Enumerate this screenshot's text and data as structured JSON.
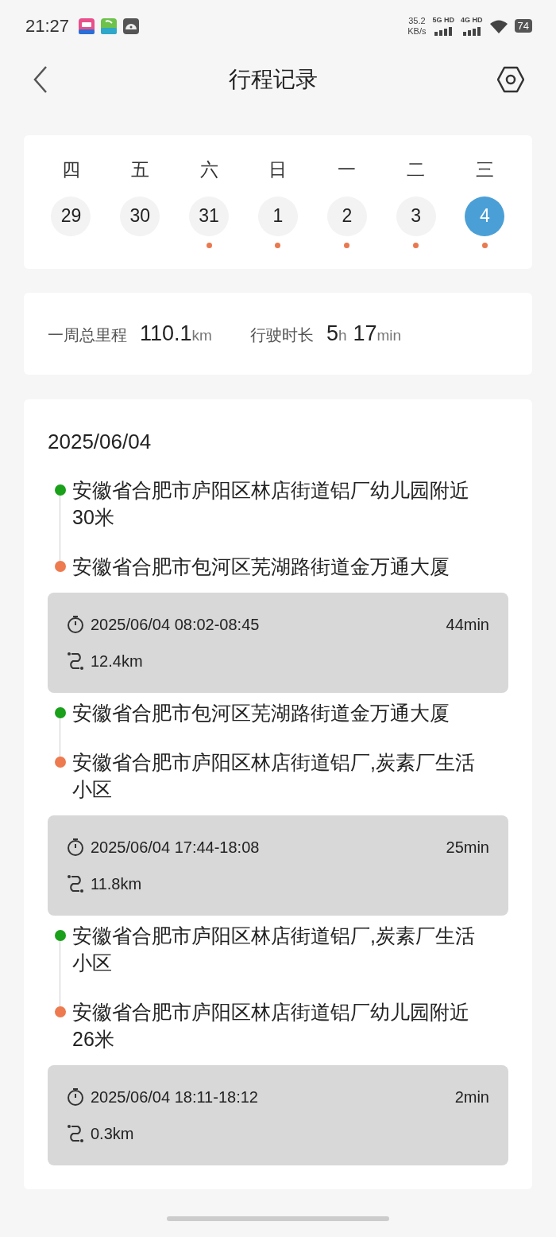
{
  "status_bar": {
    "time": "21:27",
    "speed": "35.2",
    "speed_unit": "KB/s",
    "networks": [
      "5G HD",
      "4G HD"
    ],
    "battery": "74"
  },
  "header": {
    "title": "行程记录"
  },
  "week": [
    {
      "weekday": "四",
      "date": "29",
      "selected": false,
      "has_trip": false
    },
    {
      "weekday": "五",
      "date": "30",
      "selected": false,
      "has_trip": false
    },
    {
      "weekday": "六",
      "date": "31",
      "selected": false,
      "has_trip": true
    },
    {
      "weekday": "日",
      "date": "1",
      "selected": false,
      "has_trip": true
    },
    {
      "weekday": "一",
      "date": "2",
      "selected": false,
      "has_trip": true
    },
    {
      "weekday": "二",
      "date": "3",
      "selected": false,
      "has_trip": true
    },
    {
      "weekday": "三",
      "date": "4",
      "selected": true,
      "has_trip": true
    }
  ],
  "summary": [
    {
      "label": "一周总里程",
      "parts": [
        {
          "value": "110.1",
          "unit": "km"
        }
      ]
    },
    {
      "label": "行驶时长",
      "parts": [
        {
          "value": "5",
          "unit": "h"
        },
        {
          "value": "17",
          "unit": "min"
        }
      ]
    }
  ],
  "day": {
    "date": "2025/06/04",
    "trips": [
      {
        "start": "安徽省合肥市庐阳区林店街道铝厂幼儿园附近30米",
        "end": "安徽省合肥市包河区芜湖路街道金万通大厦",
        "time": "2025/06/04 08:02-08:45",
        "duration": "44min",
        "distance": "12.4km"
      },
      {
        "start": "安徽省合肥市包河区芜湖路街道金万通大厦",
        "end": "安徽省合肥市庐阳区林店街道铝厂,炭素厂生活小区",
        "time": "2025/06/04 17:44-18:08",
        "duration": "25min",
        "distance": "11.8km"
      },
      {
        "start": "安徽省合肥市庐阳区林店街道铝厂,炭素厂生活小区",
        "end": "安徽省合肥市庐阳区林店街道铝厂幼儿园附近26米",
        "time": "2025/06/04 18:11-18:12",
        "duration": "2min",
        "distance": "0.3km"
      }
    ]
  }
}
